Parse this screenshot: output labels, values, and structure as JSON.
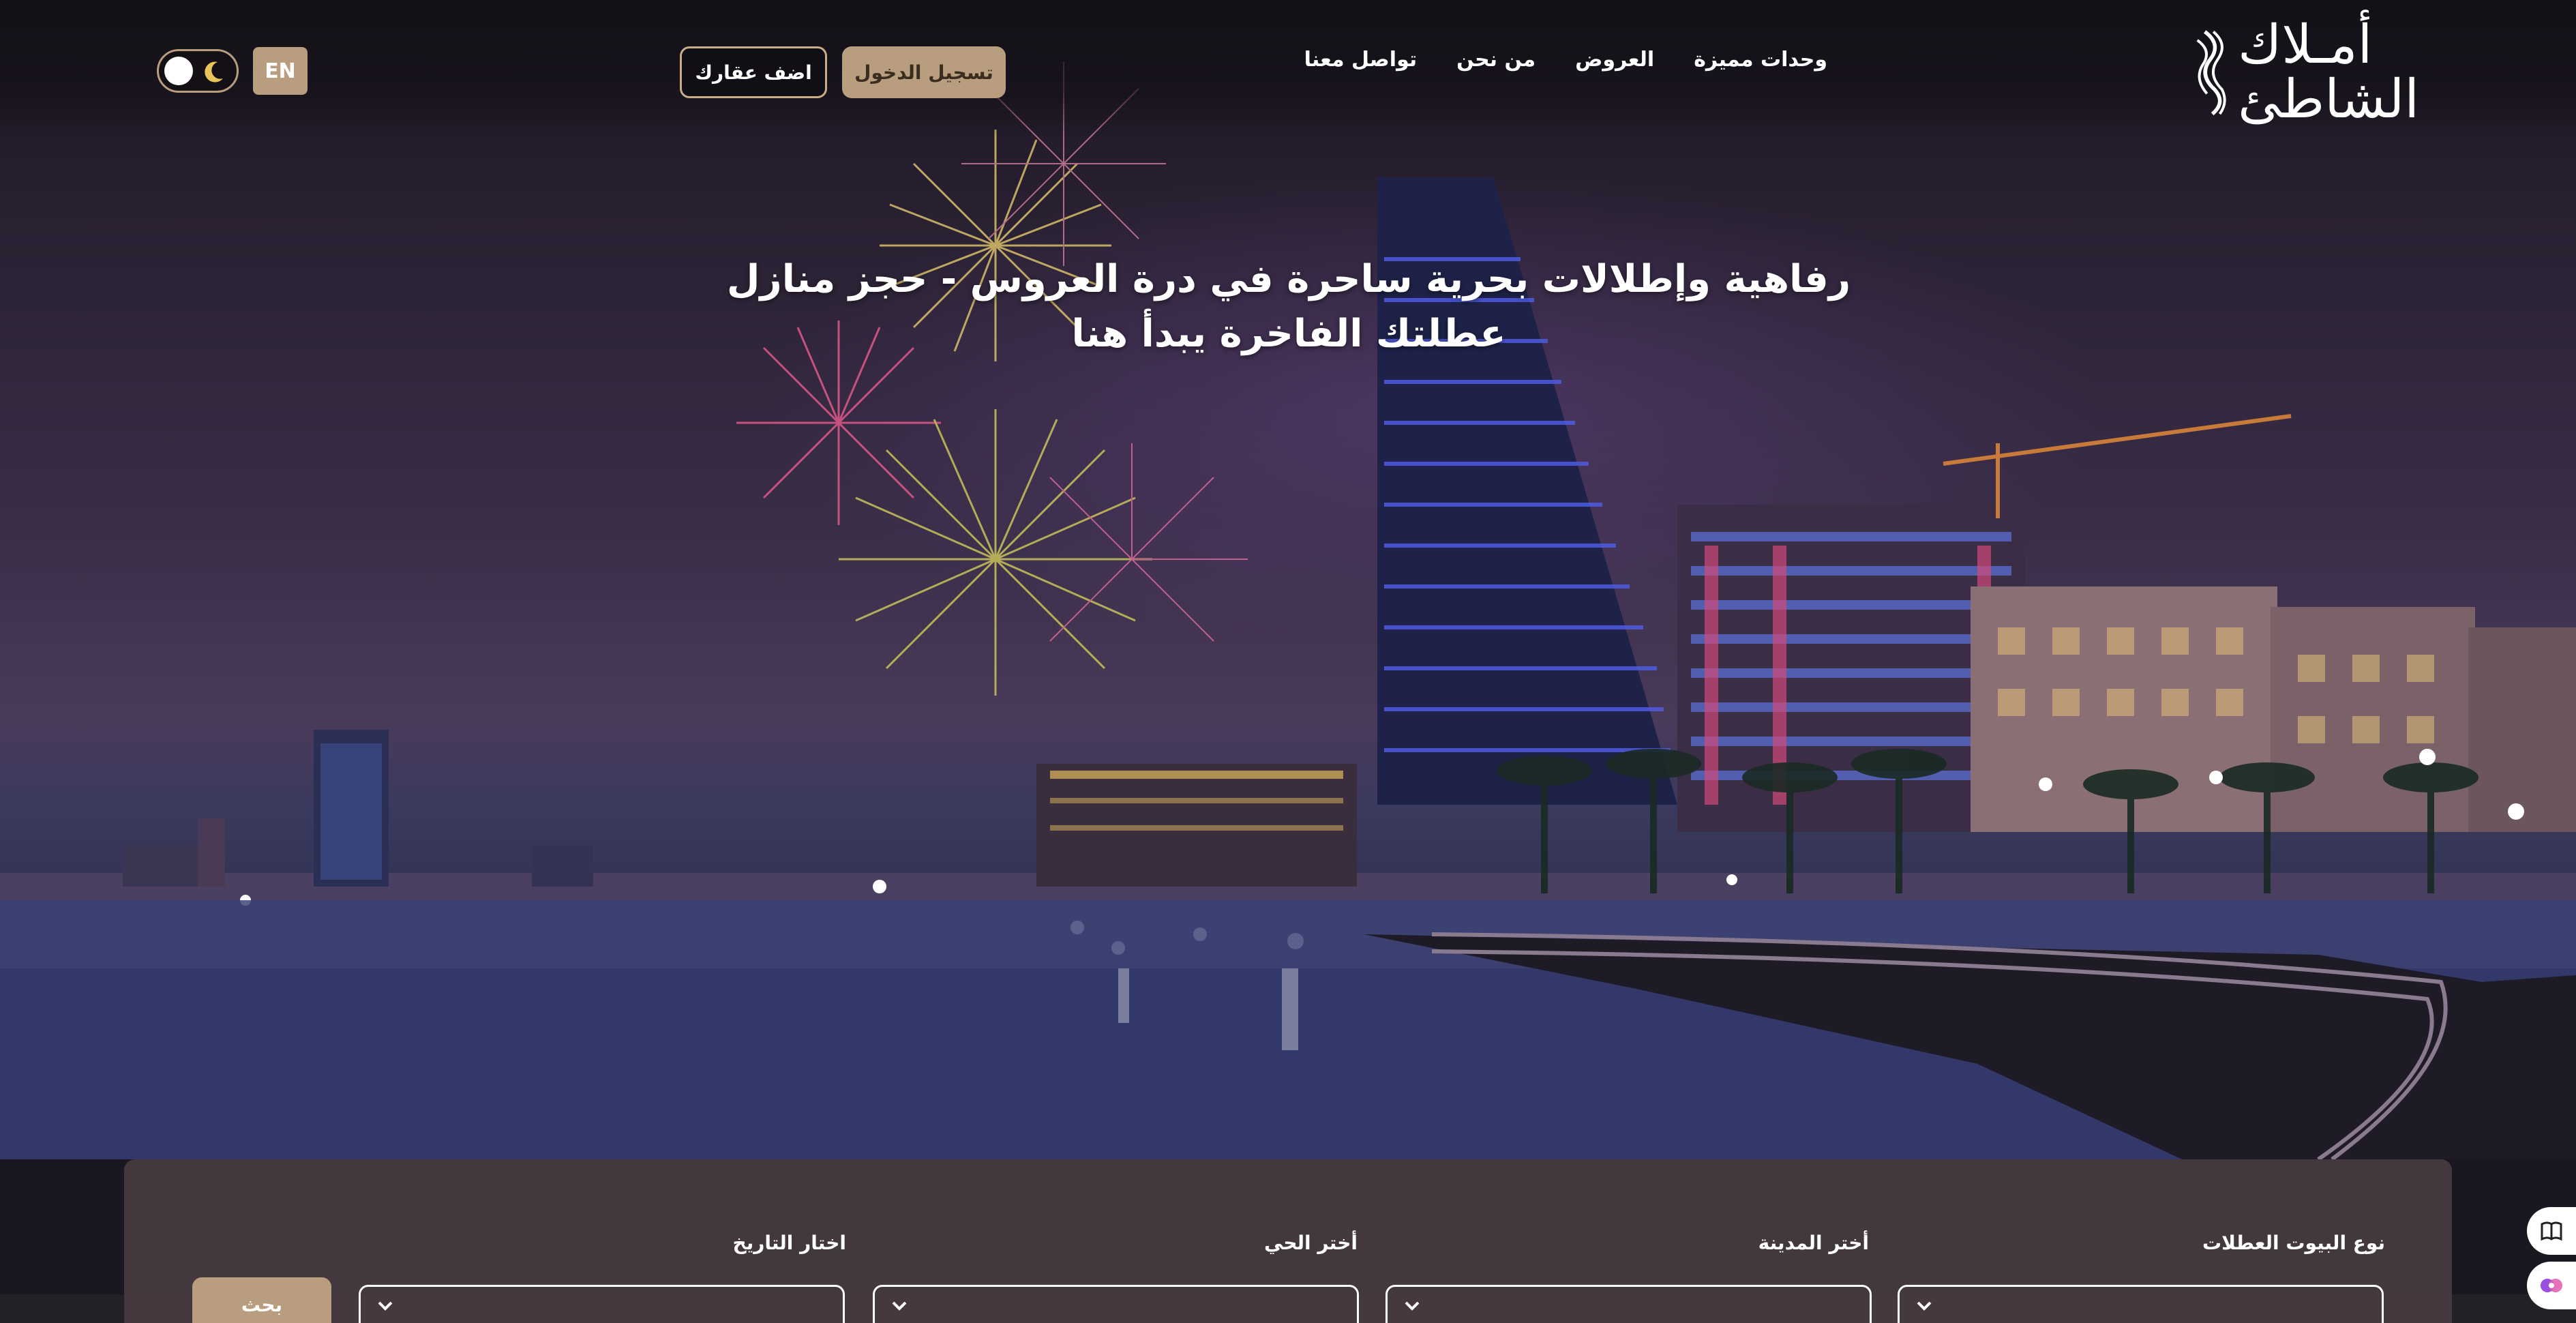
{
  "brand": {
    "logo_line1": "أمـلاك",
    "logo_line2": "الشاطئ"
  },
  "nav": {
    "items": [
      {
        "label": "وحدات مميزة"
      },
      {
        "label": "العروض"
      },
      {
        "label": "من نحن"
      },
      {
        "label": "تواصل معنا"
      }
    ]
  },
  "header": {
    "login_label": "تسجيل الدخول",
    "add_property_label": "اضف عقارك",
    "language_label": "EN",
    "theme": "dark"
  },
  "hero": {
    "title": "رفاهية وإطلالات بحرية ساحرة في درة العروس - حجز منازل عطلتك الفاخرة يبدأ هنا"
  },
  "search": {
    "fields": [
      {
        "label": "نوع البيوت العطلات",
        "value": ""
      },
      {
        "label": "أختر المدينة",
        "value": ""
      },
      {
        "label": "أختر الحي",
        "value": ""
      },
      {
        "label": "اختار التاريخ",
        "value": ""
      }
    ],
    "submit_label": "بحث"
  },
  "colors": {
    "accent": "#b89e7e",
    "panel": "#463a40",
    "header_bg": "#141118"
  },
  "widgets": [
    {
      "icon": "book-icon"
    },
    {
      "icon": "accessibility-icon"
    }
  ]
}
